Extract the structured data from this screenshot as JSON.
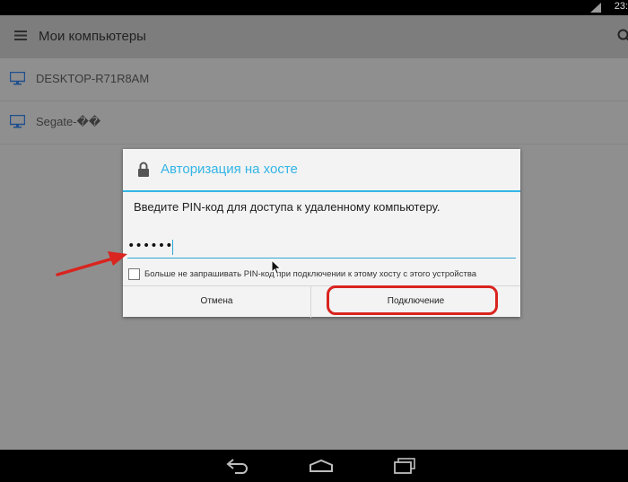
{
  "status_bar": {
    "time": "23:"
  },
  "action_bar": {
    "title": "Мои компьютеры"
  },
  "hosts": [
    {
      "name": "DESKTOP-R71R8AM"
    },
    {
      "name": "Segate-��"
    }
  ],
  "dialog": {
    "title": "Авторизация на хосте",
    "message": "Введите PIN-код для доступа к удаленному компьютеру.",
    "pin_value": "••••••",
    "checkbox_label": "Больше не запрашивать PIN-код при подключении к этому хосту с этого устройства",
    "cancel_label": "Отмена",
    "connect_label": "Подключение"
  },
  "icons": {
    "menu": "hamburger-menu-icon",
    "search": "search-icon",
    "monitor": "monitor-icon",
    "lock": "lock-icon",
    "back": "back-icon",
    "home": "home-icon",
    "recents": "recents-icon"
  },
  "colors": {
    "accent": "#33b5e5",
    "annotation": "#d9241f"
  }
}
